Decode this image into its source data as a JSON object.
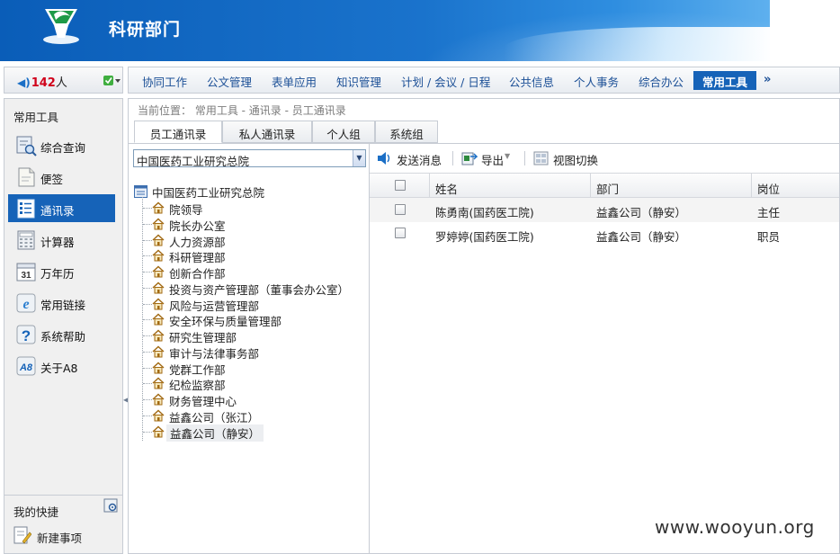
{
  "header": {
    "title": "科研部门"
  },
  "status": {
    "online_count": "142",
    "online_unit": "人"
  },
  "nav": {
    "items": [
      {
        "label": "协同工作"
      },
      {
        "label": "公文管理"
      },
      {
        "label": "表单应用"
      },
      {
        "label": "知识管理"
      },
      {
        "label": "计划 / 会议 / 日程"
      },
      {
        "label": "公共信息"
      },
      {
        "label": "个人事务"
      },
      {
        "label": "综合办公"
      },
      {
        "label": "常用工具"
      }
    ],
    "active_index": 8,
    "more_icon": "double-chevron-right-icon"
  },
  "sidebar": {
    "title": "常用工具",
    "items": [
      {
        "label": "综合查询",
        "icon": "search-query-icon"
      },
      {
        "label": "便签",
        "icon": "note-icon"
      },
      {
        "label": "通讯录",
        "icon": "address-book-icon"
      },
      {
        "label": "计算器",
        "icon": "calculator-icon"
      },
      {
        "label": "万年历",
        "icon": "calendar-icon"
      },
      {
        "label": "常用链接",
        "icon": "link-icon"
      },
      {
        "label": "系统帮助",
        "icon": "help-icon"
      },
      {
        "label": "关于A8",
        "icon": "about-icon"
      }
    ],
    "active_index": 2,
    "quick": {
      "title": "我的快捷",
      "item_label": "新建事项"
    }
  },
  "main": {
    "breadcrumb": "当前位置： 常用工具 - 通讯录 - 员工通讯录",
    "tabs": [
      {
        "label": "员工通讯录"
      },
      {
        "label": "私人通讯录"
      },
      {
        "label": "个人组"
      },
      {
        "label": "系统组"
      }
    ],
    "active_tab": 0,
    "org_select": "中国医药工业研究总院",
    "tree": {
      "root": "中国医药工业研究总院",
      "nodes": [
        "院领导",
        "院长办公室",
        "人力资源部",
        "科研管理部",
        "创新合作部",
        "投资与资产管理部（董事会办公室）",
        "风险与运营管理部",
        "安全环保与质量管理部",
        "研究生管理部",
        "审计与法律事务部",
        "党群工作部",
        "纪检监察部",
        "财务管理中心",
        "益鑫公司（张江）",
        "益鑫公司（静安）"
      ],
      "selected_index": 14
    },
    "toolbar": {
      "send": "发送消息",
      "export": "导出",
      "view_switch": "视图切换"
    },
    "grid": {
      "columns": [
        "姓名",
        "部门",
        "岗位"
      ],
      "rows": [
        {
          "name": "陈勇南(国药医工院)",
          "dept": "益鑫公司（静安）",
          "post": "主任"
        },
        {
          "name": "罗婷婷(国药医工院)",
          "dept": "益鑫公司（静安）",
          "post": "职员"
        }
      ]
    }
  },
  "watermark": "www.wooyun.org"
}
